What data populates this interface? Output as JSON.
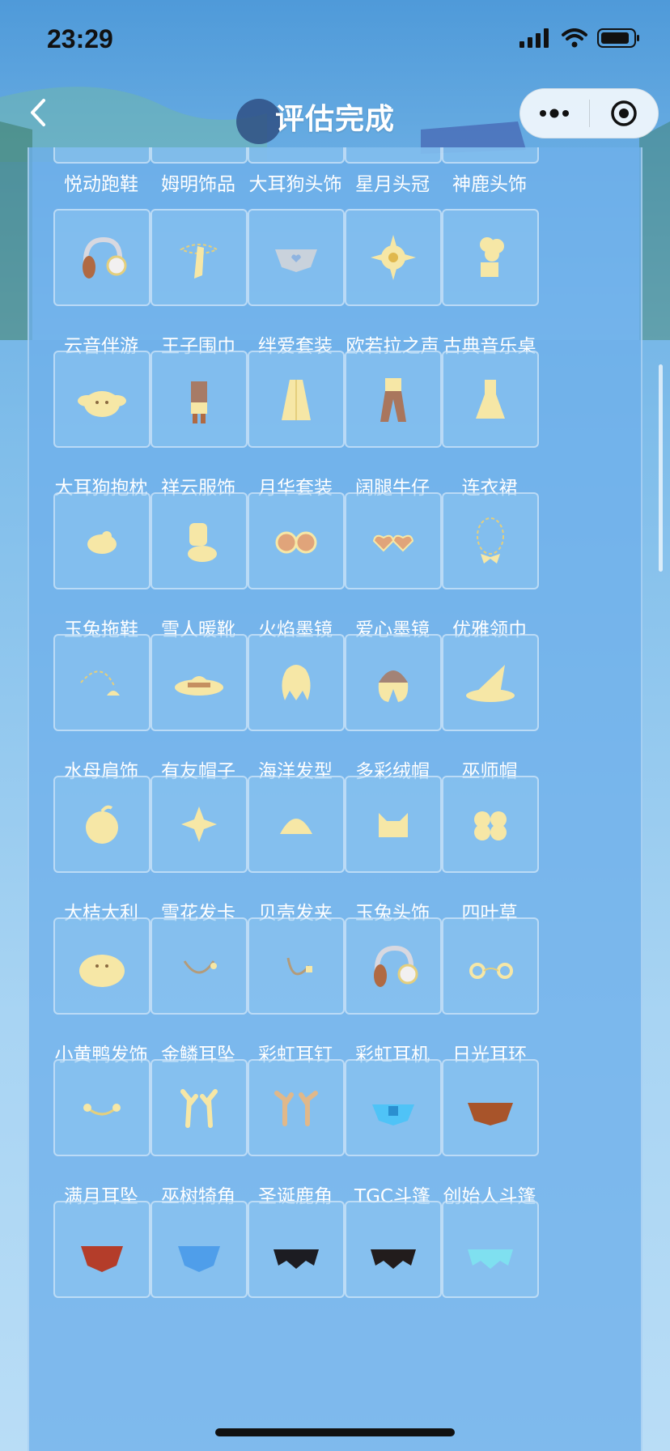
{
  "status": {
    "time": "23:29"
  },
  "nav": {
    "title": "评估完成"
  },
  "colors": {
    "item_gold": "#f6e7a6",
    "tile_border": "#d8ecfb",
    "panel": "#6eb0eb"
  },
  "rows": [
    {
      "partial": true,
      "items": [
        {
          "label": "悦动跑鞋",
          "icon": "shoe-icon"
        },
        {
          "label": "姆明饰品",
          "icon": "ornament-icon"
        },
        {
          "label": "大耳狗头饰",
          "icon": "dog-headwear-icon"
        },
        {
          "label": "星月头冠",
          "icon": "crown-icon"
        },
        {
          "label": "神鹿头饰",
          "icon": "deer-headwear-icon"
        }
      ]
    },
    {
      "items": [
        {
          "label": "云音伴游",
          "icon": "headphone-icon"
        },
        {
          "label": "王子围巾",
          "icon": "scarf-icon"
        },
        {
          "label": "绊爱套装",
          "icon": "cape-heart-icon"
        },
        {
          "label": "欧若拉之声",
          "icon": "sun-star-icon"
        },
        {
          "label": "古典音乐桌",
          "icon": "gramophone-icon"
        }
      ]
    },
    {
      "items": [
        {
          "label": "大耳狗抱枕",
          "icon": "dog-pillow-icon"
        },
        {
          "label": "祥云服饰",
          "icon": "outfit-icon"
        },
        {
          "label": "月华套装",
          "icon": "robe-icon"
        },
        {
          "label": "阔腿牛仔",
          "icon": "jeans-icon"
        },
        {
          "label": "连衣裙",
          "icon": "dress-icon"
        }
      ]
    },
    {
      "items": [
        {
          "label": "玉兔拖鞋",
          "icon": "slipper-icon"
        },
        {
          "label": "雪人暖靴",
          "icon": "boot-icon"
        },
        {
          "label": "火焰墨镜",
          "icon": "flame-glasses-icon"
        },
        {
          "label": "爱心墨镜",
          "icon": "heart-glasses-icon"
        },
        {
          "label": "优雅领巾",
          "icon": "bow-necklace-icon"
        }
      ]
    },
    {
      "items": [
        {
          "label": "水母肩饰",
          "icon": "jellyfish-icon"
        },
        {
          "label": "有友帽子",
          "icon": "sun-hat-icon"
        },
        {
          "label": "海洋发型",
          "icon": "wavy-hair-icon"
        },
        {
          "label": "多彩绒帽",
          "icon": "beanie-hair-icon"
        },
        {
          "label": "巫师帽",
          "icon": "wizard-hat-icon"
        }
      ]
    },
    {
      "items": [
        {
          "label": "大桔大利",
          "icon": "orange-icon"
        },
        {
          "label": "雪花发卡",
          "icon": "snowflake-icon"
        },
        {
          "label": "贝壳发夹",
          "icon": "shell-icon"
        },
        {
          "label": "玉兔头饰",
          "icon": "cat-head-icon"
        },
        {
          "label": "四叶草",
          "icon": "clover-icon"
        }
      ]
    },
    {
      "items": [
        {
          "label": "小黄鸭发饰",
          "icon": "duck-icon"
        },
        {
          "label": "金鳞耳坠",
          "icon": "earring-icon"
        },
        {
          "label": "彩虹耳钉",
          "icon": "ear-stud-icon"
        },
        {
          "label": "彩虹耳机",
          "icon": "headphone-icon"
        },
        {
          "label": "日光耳环",
          "icon": "sun-earring-icon"
        }
      ]
    },
    {
      "items": [
        {
          "label": "满月耳坠",
          "icon": "moon-earring-icon"
        },
        {
          "label": "巫树犄角",
          "icon": "antler-icon"
        },
        {
          "label": "圣诞鹿角",
          "icon": "reindeer-antler-icon"
        },
        {
          "label": "TGC斗篷",
          "icon": "tgc-cape-icon"
        },
        {
          "label": "创始人斗篷",
          "icon": "founder-cape-icon"
        }
      ]
    },
    {
      "partial": true,
      "items": [
        {
          "label": "",
          "icon": "red-cape-icon"
        },
        {
          "label": "",
          "icon": "blue-cape-icon"
        },
        {
          "label": "",
          "icon": "bat-cape-icon"
        },
        {
          "label": "",
          "icon": "spider-cape-icon"
        },
        {
          "label": "",
          "icon": "cyan-cape-icon"
        }
      ]
    }
  ]
}
